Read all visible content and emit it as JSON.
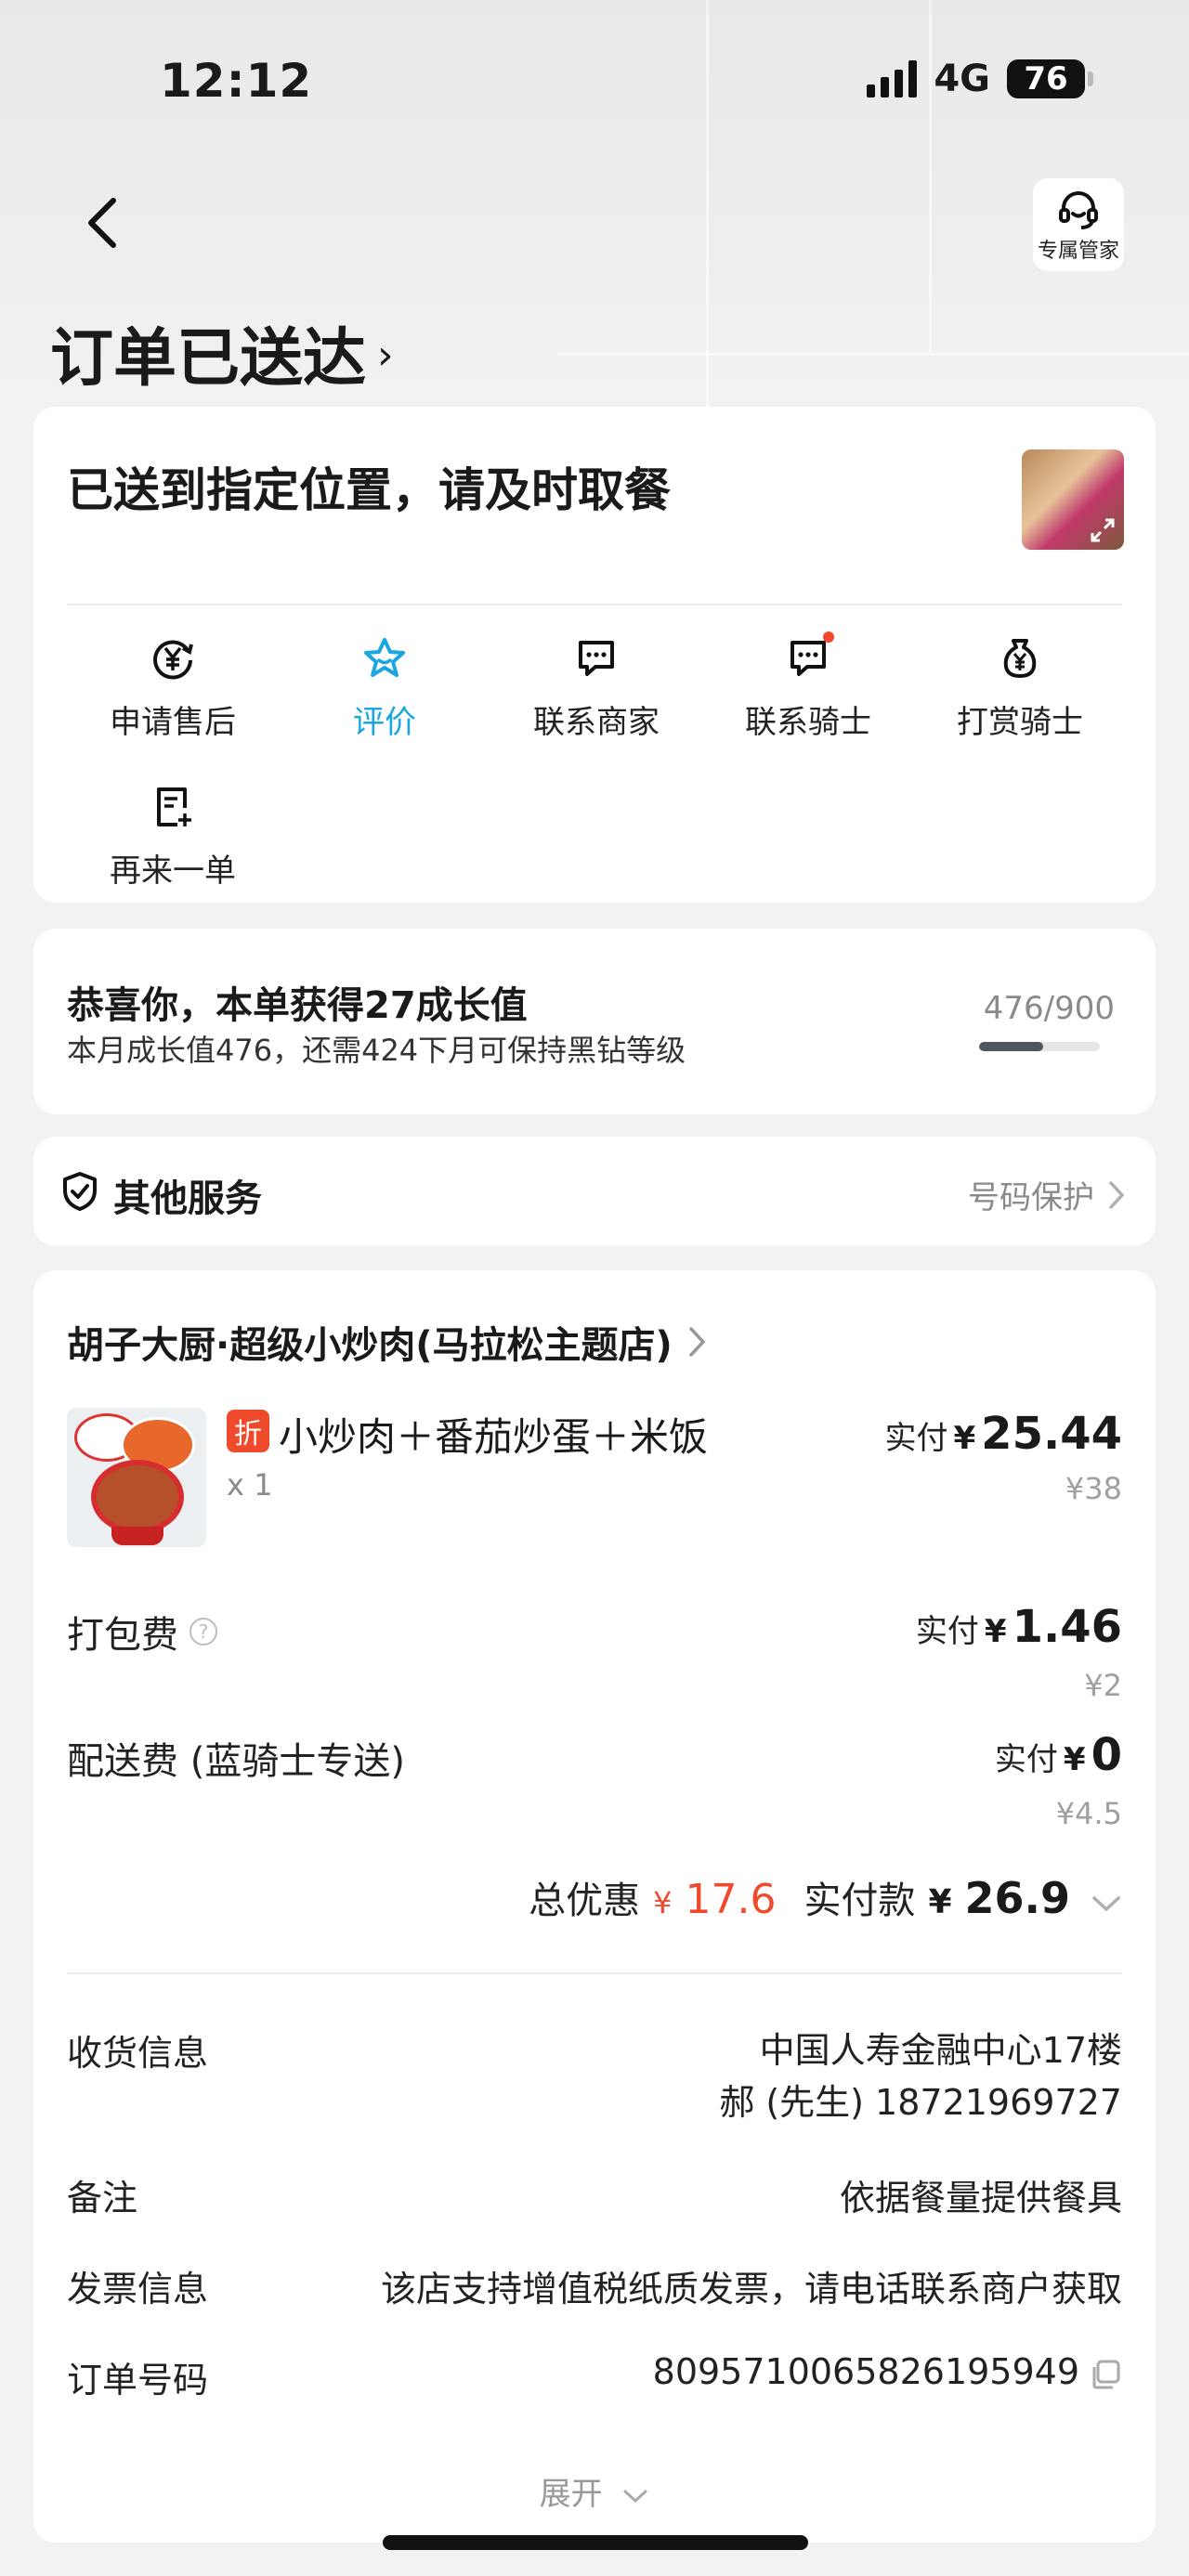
{
  "status_bar": {
    "time": "12:12",
    "network": "4G",
    "battery": "76"
  },
  "header": {
    "service_label": "专属管家",
    "title": "订单已送达",
    "title_chevron": "›"
  },
  "delivery_card": {
    "message": "已送到指定位置，请及时取餐",
    "actions": [
      {
        "label": "申请售后",
        "icon": "yen-refund-icon"
      },
      {
        "label": "评价",
        "icon": "star-icon",
        "active": true
      },
      {
        "label": "联系商家",
        "icon": "chat-icon"
      },
      {
        "label": "联系骑士",
        "icon": "chat-icon",
        "badge": true
      },
      {
        "label": "打赏骑士",
        "icon": "money-bag-icon"
      },
      {
        "label": "再来一单",
        "icon": "reorder-icon"
      }
    ]
  },
  "growth_card": {
    "headline": "恭喜你，本单获得27成长值",
    "detail": "本月成长值476，还需424下月可保持黑钻等级",
    "progress_text": "476/900",
    "progress_fraction": 0.529
  },
  "services_card": {
    "title": "其他服务",
    "right_label": "号码保护"
  },
  "order_card": {
    "shop_name": "胡子大厨·超级小炒肉(马拉松主题店)",
    "item": {
      "badge": "折",
      "name": "小炒肉＋番茄炒蛋＋米饭",
      "qty": "x 1",
      "paid_label": "实付",
      "currency": "¥",
      "paid": "25.44",
      "original": "¥38"
    },
    "packing_fee": {
      "label": "打包费",
      "paid_label": "实付",
      "currency": "¥",
      "paid": "1.46",
      "original": "¥2"
    },
    "delivery_fee": {
      "label": "配送费 (蓝骑士专送)",
      "paid_label": "实付",
      "currency": "¥",
      "paid": "0",
      "original": "¥4.5"
    },
    "totals": {
      "discount_label": "总优惠",
      "discount_currency": "¥",
      "discount": "17.6",
      "pay_label": "实付款",
      "pay_currency": "¥",
      "pay": "26.9"
    },
    "info": {
      "address_label": "收货信息",
      "address_line1": "中国人寿金融中心17楼",
      "address_line2": "郝 (先生) 18721969727",
      "note_label": "备注",
      "note": "依据餐量提供餐具",
      "invoice_label": "发票信息",
      "invoice": "该店支持增值税纸质发票，请电话联系商户获取",
      "order_no_label": "订单号码",
      "order_no": "8095710065826195949"
    },
    "expand_label": "展开"
  },
  "colors": {
    "accent": "#1aa6e0",
    "discount_red": "#f04a2c",
    "background": "#f2f2f3"
  }
}
